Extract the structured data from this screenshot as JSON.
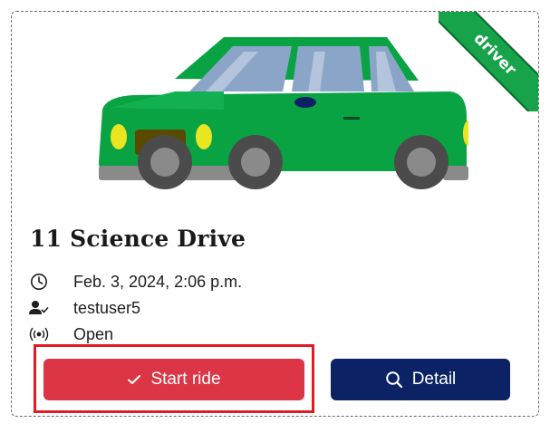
{
  "card": {
    "badge": "driver",
    "title": "11 Science Drive",
    "details": [
      {
        "icon": "clock-icon",
        "text": "Feb. 3, 2024, 2:06 p.m."
      },
      {
        "icon": "user-check-icon",
        "text": "testuser5"
      },
      {
        "icon": "broadcast-icon",
        "text": "Open"
      }
    ],
    "buttons": {
      "start_label": "Start ride",
      "detail_label": "Detail"
    }
  },
  "colors": {
    "car_body": "#0aa344",
    "start_button": "#dc3545",
    "detail_button": "#0b2265",
    "badge": "#16a34a",
    "highlight": "#e01b24"
  }
}
